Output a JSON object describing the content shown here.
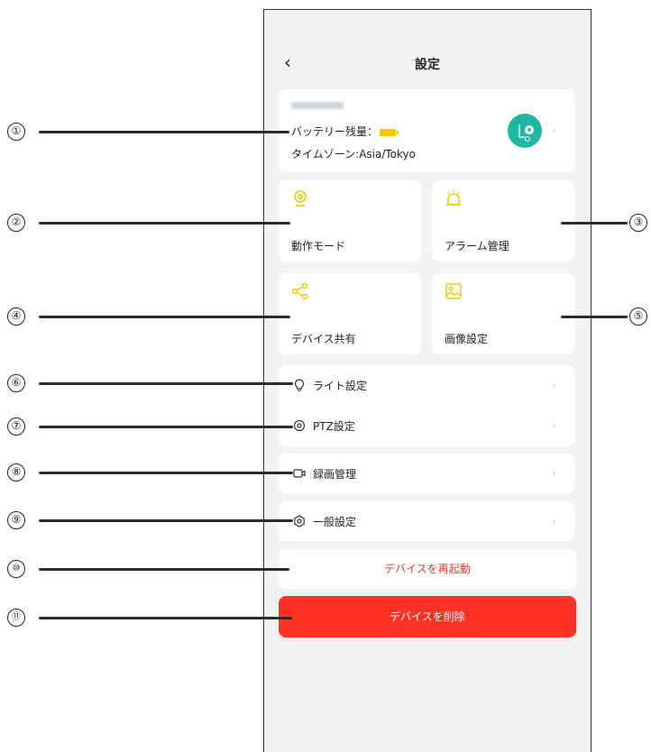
{
  "header": {
    "back_icon": "chevron-left-icon",
    "title": "設定"
  },
  "device": {
    "battery_label": "バッテリー残量：",
    "timezone": "タイムゾーン:Asia/Tokyo",
    "avatar_color": "#1fb7a1"
  },
  "tiles": [
    {
      "label": "動作モード",
      "icon": "camera-icon"
    },
    {
      "label": "アラーム管理",
      "icon": "alarm-icon"
    },
    {
      "label": "デバイス共有",
      "icon": "share-icon"
    },
    {
      "label": "画像設定",
      "icon": "image-icon"
    }
  ],
  "rows": [
    {
      "label": "ライト設定",
      "icon": "lightbulb-icon"
    },
    {
      "label": "PTZ設定",
      "icon": "ptz-icon"
    },
    {
      "label": "録画管理",
      "icon": "video-icon"
    },
    {
      "label": "一般設定",
      "icon": "settings-icon"
    }
  ],
  "actions": {
    "restart": "デバイスを再起動",
    "delete": "デバイスを削除"
  },
  "callouts": [
    "①",
    "②",
    "③",
    "④",
    "⑤",
    "⑥",
    "⑦",
    "⑧",
    "⑨",
    "⑩",
    "⑪"
  ],
  "colors": {
    "accent": "#f7c600",
    "danger": "#ff3225",
    "teal": "#1fb7a1"
  }
}
